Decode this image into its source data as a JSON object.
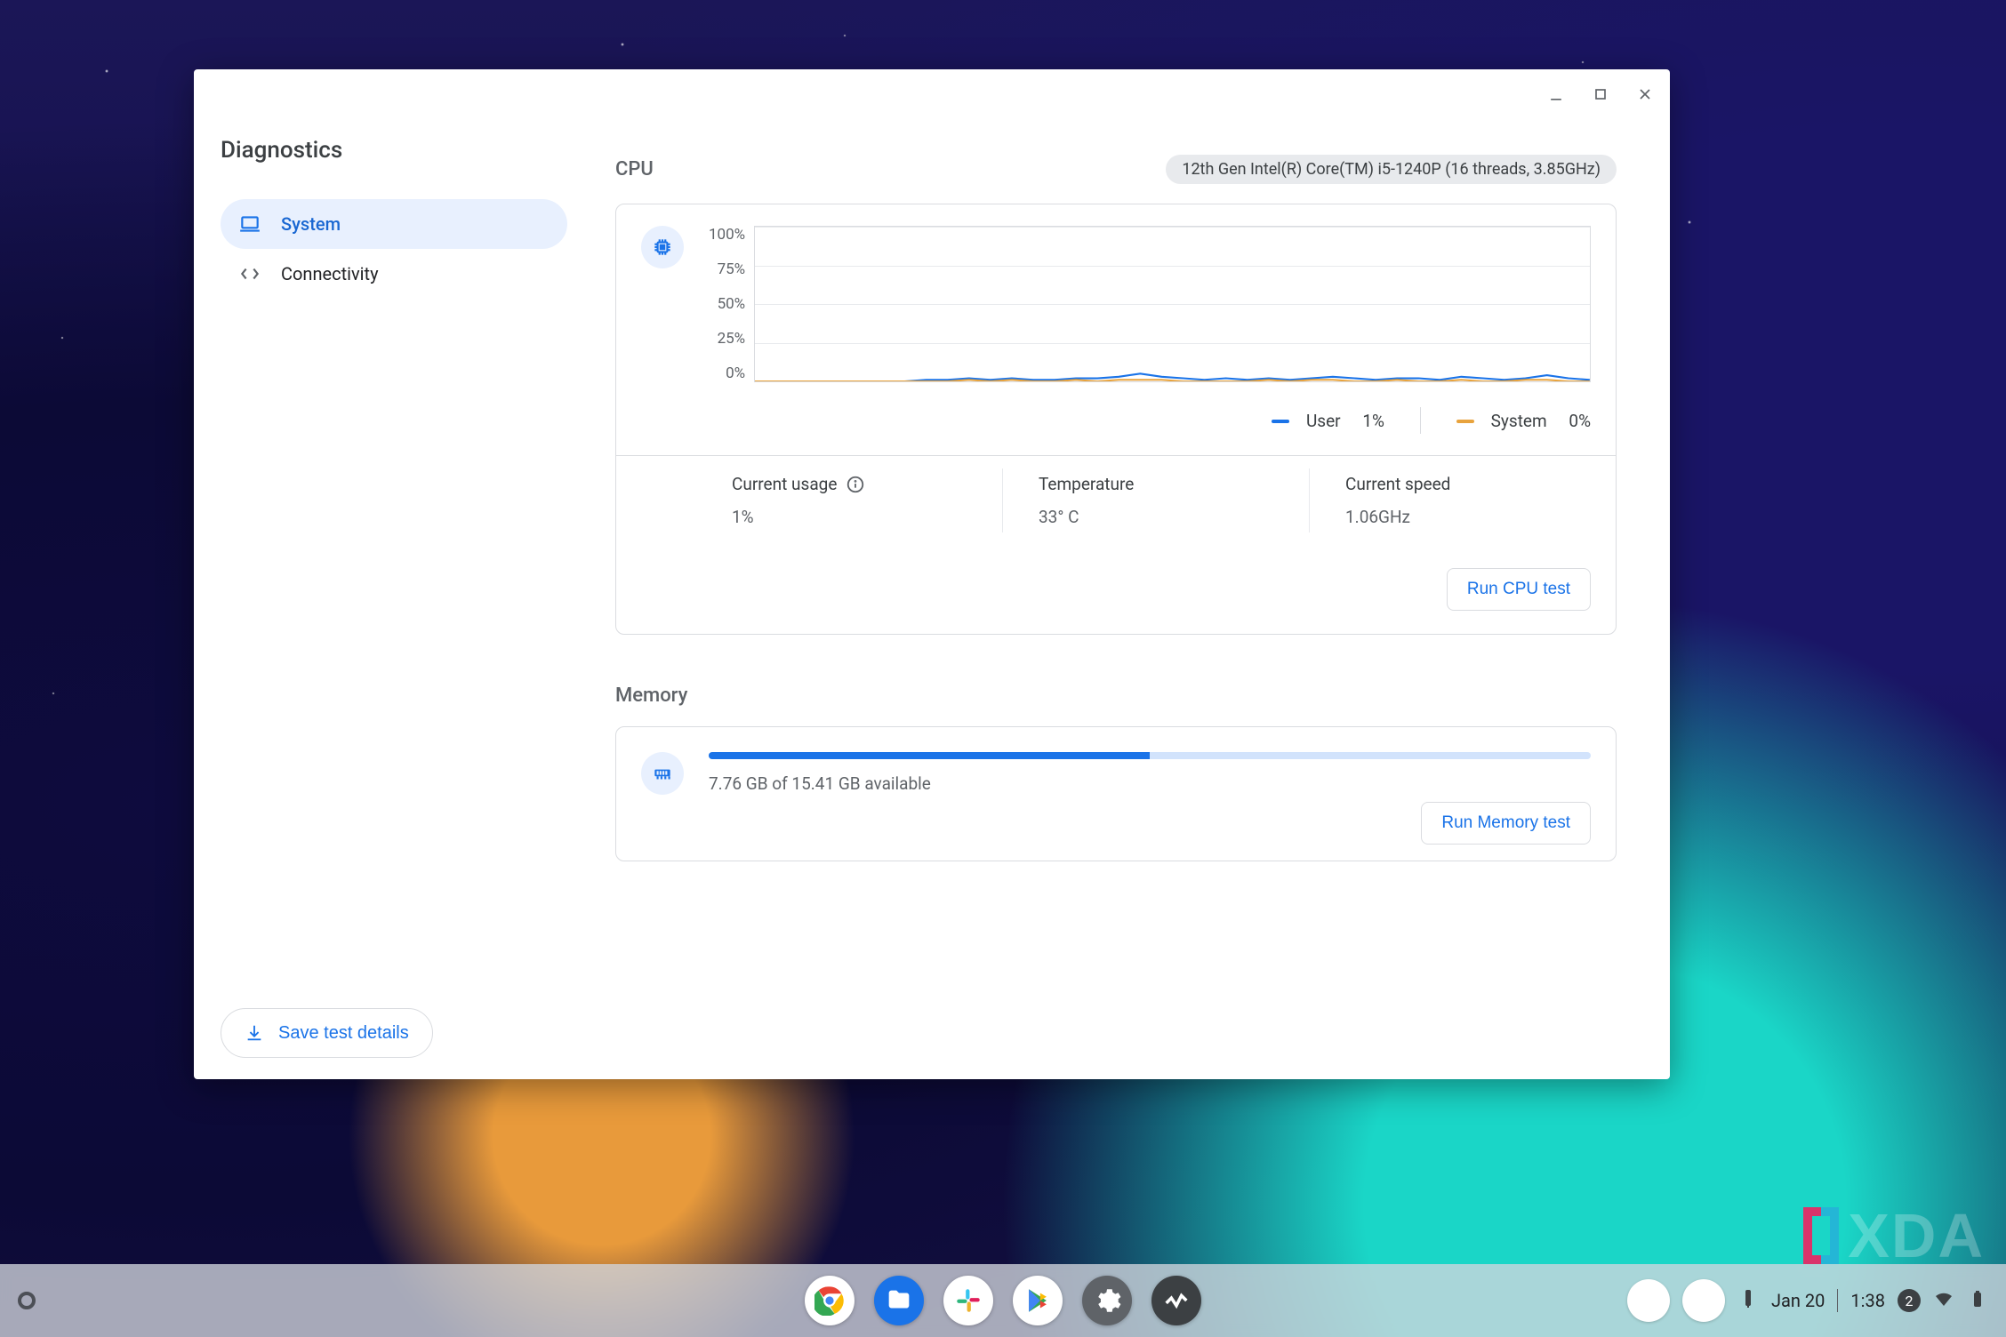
{
  "app_title": "Diagnostics",
  "sidebar": {
    "items": [
      {
        "label": "System",
        "icon": "laptop-icon",
        "active": true
      },
      {
        "label": "Connectivity",
        "icon": "arrows-horizontal-icon",
        "active": false
      }
    ],
    "save_button": "Save test details"
  },
  "cpu": {
    "title": "CPU",
    "model_chip": "12th Gen Intel(R) Core(TM) i5-1240P (16 threads, 3.85GHz)",
    "legend_user_label": "User",
    "legend_user_value": "1%",
    "legend_system_label": "System",
    "legend_system_value": "0%",
    "usage_label": "Current usage",
    "usage_value": "1%",
    "temp_label": "Temperature",
    "temp_value": "33° C",
    "speed_label": "Current speed",
    "speed_value": "1.06GHz",
    "test_button": "Run CPU test"
  },
  "memory": {
    "title": "Memory",
    "text": "7.76 GB of 15.41 GB available",
    "used_pct": 50,
    "test_button": "Run Memory test"
  },
  "shelf": {
    "date": "Jan 20",
    "time": "1:38",
    "notifications": "2"
  },
  "watermark": "XDA",
  "chart_data": {
    "type": "line",
    "title": "CPU usage",
    "ylabel": "%",
    "ylim": [
      0,
      100
    ],
    "y_ticks": [
      "100%",
      "75%",
      "50%",
      "25%",
      "0%"
    ],
    "series": [
      {
        "name": "User",
        "color": "#1a73e8",
        "values": [
          0,
          0,
          0,
          0,
          0,
          0,
          0,
          0,
          1,
          1,
          2,
          1,
          2,
          1,
          1,
          2,
          2,
          3,
          5,
          3,
          2,
          1,
          2,
          1,
          2,
          1,
          2,
          3,
          2,
          1,
          2,
          2,
          1,
          3,
          2,
          1,
          2,
          4,
          2,
          1
        ]
      },
      {
        "name": "System",
        "color": "#e8a33d",
        "values": [
          0,
          0,
          0,
          0,
          0,
          0,
          0,
          0,
          0,
          0,
          1,
          0,
          1,
          0,
          0,
          1,
          0,
          1,
          1,
          1,
          0,
          0,
          0,
          0,
          1,
          0,
          1,
          1,
          0,
          0,
          1,
          0,
          0,
          1,
          0,
          0,
          1,
          1,
          0,
          0
        ]
      }
    ]
  }
}
